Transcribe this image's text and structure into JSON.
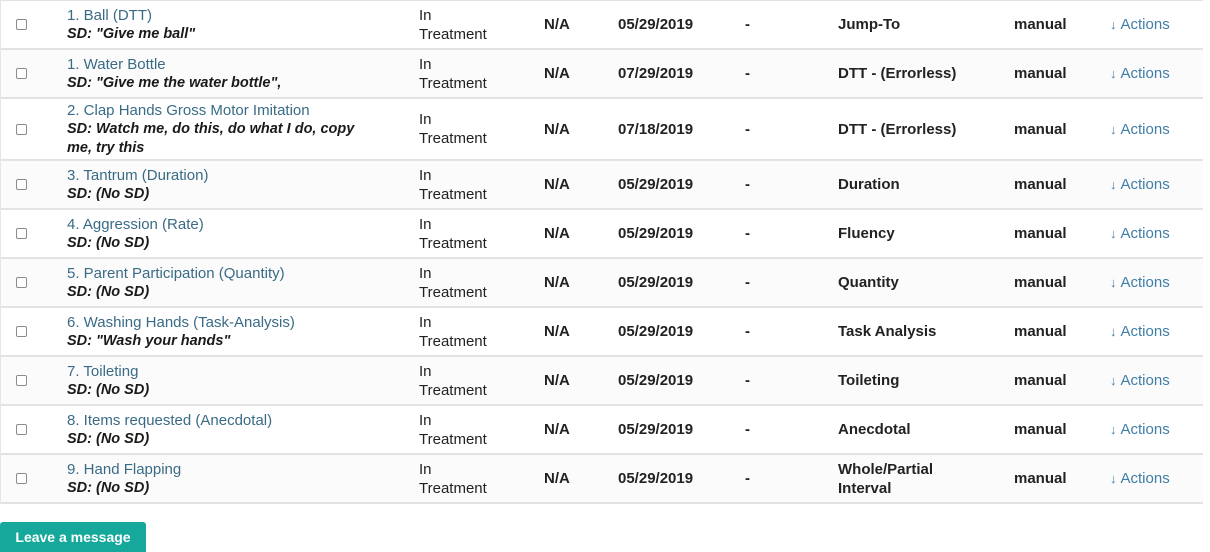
{
  "rows": [
    {
      "name": "1. Ball (DTT)",
      "sd": "SD: \"Give me ball\"",
      "status_line1": "In",
      "status_line2": "Treatment",
      "mastery": "N/A",
      "date": "05/29/2019",
      "dash": "-",
      "type": "Jump-To",
      "mode": "manual",
      "actions": "Actions"
    },
    {
      "name": "1. Water Bottle",
      "sd": "SD: \"Give me the water bottle\",",
      "status_line1": "In",
      "status_line2": "Treatment",
      "mastery": "N/A",
      "date": "07/29/2019",
      "dash": "-",
      "type": "DTT - (Errorless)",
      "mode": "manual",
      "actions": "Actions"
    },
    {
      "name": "2. Clap Hands Gross Motor Imitation",
      "sd": "SD: Watch me, do this, do what I do, copy me, try this",
      "status_line1": "In",
      "status_line2": "Treatment",
      "mastery": "N/A",
      "date": "07/18/2019",
      "dash": "-",
      "type": "DTT - (Errorless)",
      "mode": "manual",
      "actions": "Actions"
    },
    {
      "name": "3. Tantrum (Duration)",
      "sd": "SD: (No SD)",
      "status_line1": "In",
      "status_line2": "Treatment",
      "mastery": "N/A",
      "date": "05/29/2019",
      "dash": "-",
      "type": "Duration",
      "mode": "manual",
      "actions": "Actions"
    },
    {
      "name": "4. Aggression (Rate)",
      "sd": "SD: (No SD)",
      "status_line1": "In",
      "status_line2": "Treatment",
      "mastery": "N/A",
      "date": "05/29/2019",
      "dash": "-",
      "type": "Fluency",
      "mode": "manual",
      "actions": "Actions"
    },
    {
      "name": "5. Parent Participation (Quantity)",
      "sd": "SD: (No SD)",
      "status_line1": "In",
      "status_line2": "Treatment",
      "mastery": "N/A",
      "date": "05/29/2019",
      "dash": "-",
      "type": "Quantity",
      "mode": "manual",
      "actions": "Actions"
    },
    {
      "name": "6. Washing Hands (Task-Analysis)",
      "sd": "SD: \"Wash your hands\"",
      "status_line1": "In",
      "status_line2": "Treatment",
      "mastery": "N/A",
      "date": "05/29/2019",
      "dash": "-",
      "type": "Task Analysis",
      "mode": "manual",
      "actions": "Actions"
    },
    {
      "name": "7. Toileting",
      "sd": "SD: (No SD)",
      "status_line1": "In",
      "status_line2": "Treatment",
      "mastery": "N/A",
      "date": "05/29/2019",
      "dash": "-",
      "type": "Toileting",
      "mode": "manual",
      "actions": "Actions"
    },
    {
      "name": "8. Items requested (Anecdotal)",
      "sd": "SD: (No SD)",
      "status_line1": "In",
      "status_line2": "Treatment",
      "mastery": "N/A",
      "date": "05/29/2019",
      "dash": "-",
      "type": "Anecdotal",
      "mode": "manual",
      "actions": "Actions"
    },
    {
      "name": "9. Hand Flapping",
      "sd": "SD: (No SD)",
      "status_line1": "In",
      "status_line2": "Treatment",
      "mastery": "N/A",
      "date": "05/29/2019",
      "dash": "-",
      "type": "Whole/Partial Interval",
      "mode": "manual",
      "actions": "Actions"
    }
  ],
  "actions_icon": "down-arrow-icon",
  "chat": {
    "label": "Leave a message",
    "color": "#16a99b"
  }
}
